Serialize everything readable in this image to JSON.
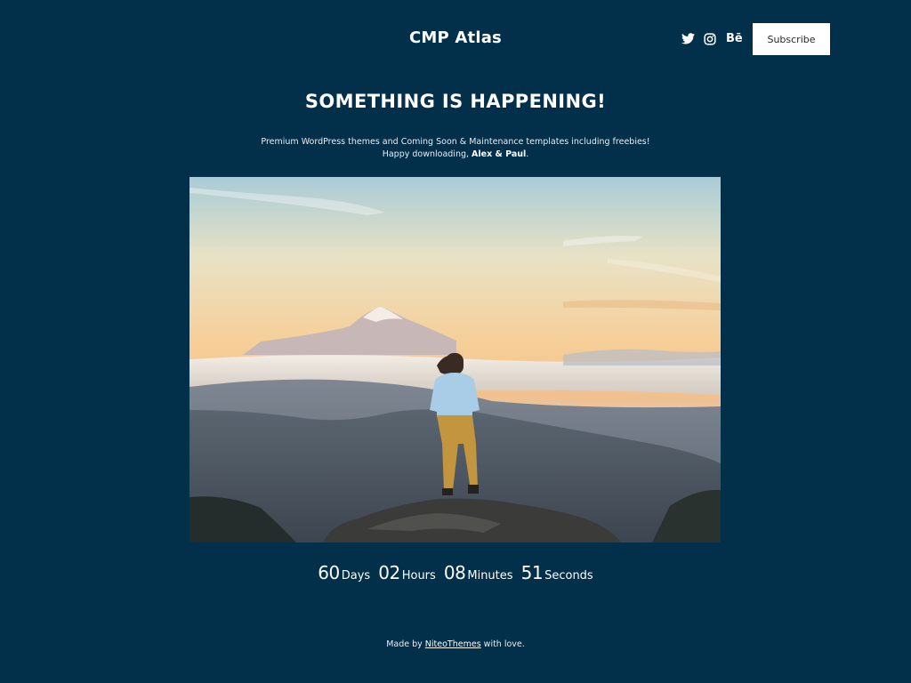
{
  "header": {
    "site_title": "CMP Atlas",
    "social_icons": [
      "twitter-icon",
      "instagram-icon",
      "behance-icon"
    ],
    "behance_glyph": "Bē",
    "subscribe_label": "Subscribe"
  },
  "main": {
    "headline": "SOMETHING IS HAPPENING!",
    "subtitle_line1": "Premium WordPress themes and Coming Soon & Maintenance templates including freebies!",
    "subtitle_line2_prefix": "Happy downloading, ",
    "subtitle_line2_bold": "Alex & Paul",
    "subtitle_line2_suffix": "."
  },
  "countdown": {
    "days_value": "60",
    "days_label": "Days",
    "hours_value": "02",
    "hours_label": "Hours",
    "minutes_value": "08",
    "minutes_label": "Minutes",
    "seconds_value": "51",
    "seconds_label": "Seconds"
  },
  "footer": {
    "prefix": "Made by ",
    "link_text": "NiteoThemes",
    "suffix": " with love."
  },
  "colors": {
    "background": "#022f49",
    "text": "#ffffff",
    "button_bg": "#ffffff",
    "button_text": "#2a2a2a"
  }
}
